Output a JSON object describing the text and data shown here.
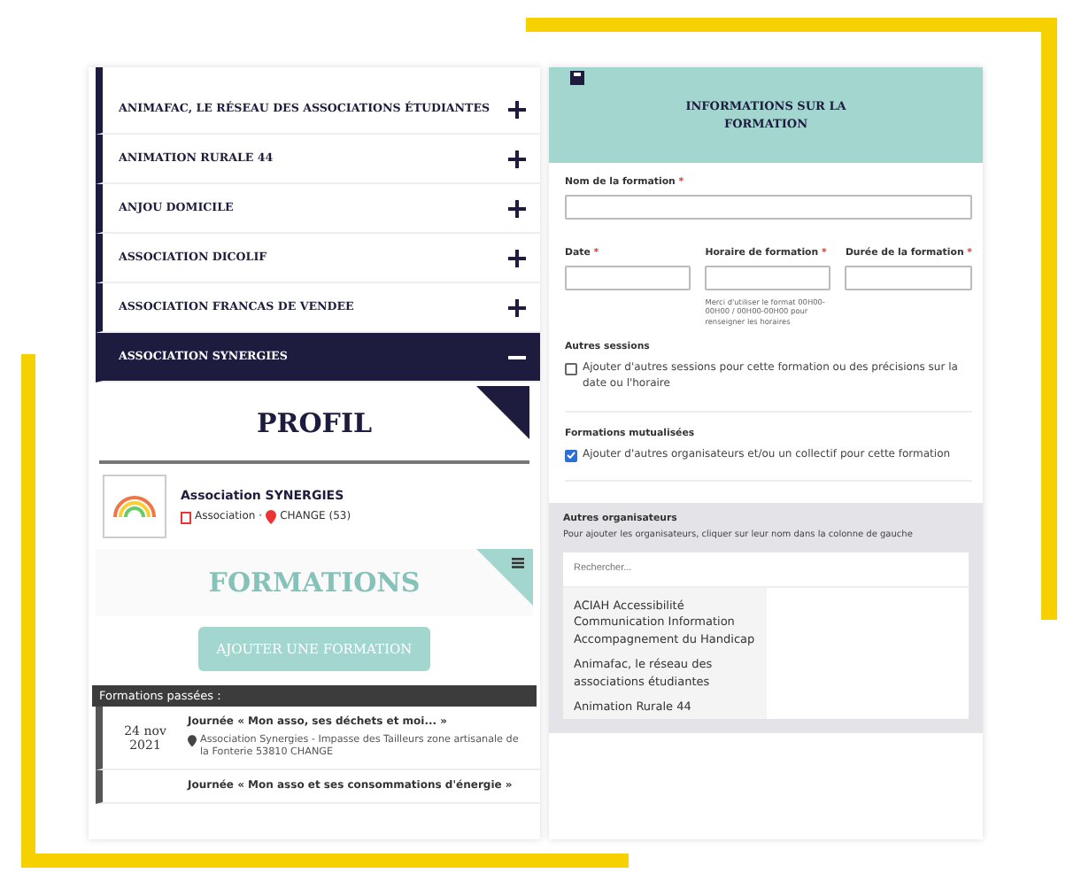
{
  "associations": [
    {
      "name": "ANIMAFAC, LE RÉSEAU DES ASSOCIATIONS ÉTUDIANTES",
      "expanded": false
    },
    {
      "name": "ANIMATION RURALE 44",
      "expanded": false
    },
    {
      "name": "ANJOU DOMICILE",
      "expanded": false
    },
    {
      "name": "ASSOCIATION DICOLIF",
      "expanded": false
    },
    {
      "name": "ASSOCIATION FRANCAS DE VENDEE",
      "expanded": false
    },
    {
      "name": "ASSOCIATION SYNERGIES",
      "expanded": true
    }
  ],
  "profile": {
    "title": "PROFIL",
    "name": "Association SYNERGIES",
    "type": "Association",
    "separator": "·",
    "city": "CHANGE (53)"
  },
  "formations": {
    "title": "FORMATIONS",
    "add_button": "AJOUTER UNE FORMATION",
    "past_label": "Formations passées :",
    "events": [
      {
        "date": "24 nov 2021",
        "title": "Journée « Mon asso, ses déchets et moi... »",
        "location": "Association Synergies - Impasse des Tailleurs zone artisanale de la Fonterie 53810 CHANGE"
      },
      {
        "title": "Journée « Mon asso et ses consommations d'énergie »"
      }
    ]
  },
  "form": {
    "title": "INFORMATIONS SUR LA FORMATION",
    "required_mark": "*",
    "name_label": "Nom de la formation",
    "date_label": "Date",
    "hours_label": "Horaire de formation",
    "duration_label": "Durée de la formation",
    "hours_hint": "Merci d'utiliser le format 00H00-00H00 / 00H00-00H00 pour renseigner les horaires",
    "sections": [
      {
        "title": "Autres sessions",
        "option": "Ajouter d'autres sessions pour cette formation ou des précisions sur la date ou l'horaire",
        "checked": false
      },
      {
        "title": "Formations mutualisées",
        "option": "Ajouter d'autres organisateurs et/ou un collectif pour cette formation",
        "checked": true
      }
    ],
    "organisers": {
      "title": "Autres organisateurs",
      "help": "Pour ajouter les organisateurs, cliquer sur leur nom dans la colonne de gauche",
      "search_placeholder": "Rechercher...",
      "items": [
        "ACIAH Accessibilité Communication Information Accompagnement du Handicap",
        "Animafac, le réseau des associations étudiantes",
        "Animation Rurale 44"
      ]
    }
  }
}
